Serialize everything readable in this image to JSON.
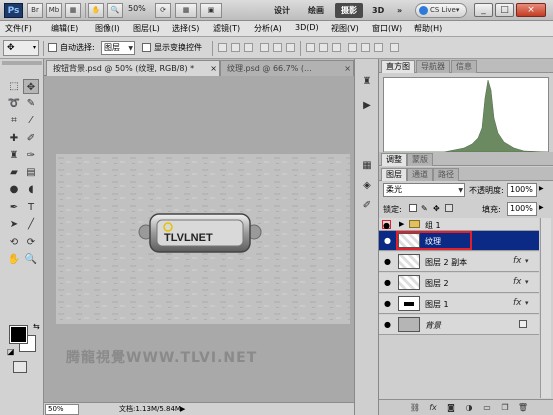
{
  "titlebar": {
    "app_logo": "Ps",
    "buttons": [
      "Br",
      "Mb"
    ],
    "zoom": "50%",
    "workspaces": [
      "设计",
      "绘画",
      "摄影",
      "3D"
    ],
    "active_workspace": "摄影",
    "more": "»",
    "cslive": "CS Live▾",
    "window_buttons": [
      "_",
      "□",
      "×"
    ]
  },
  "menubar": {
    "items": [
      "文件(F)",
      "编辑(E)",
      "图像(I)",
      "图层(L)",
      "选择(S)",
      "滤镜(T)",
      "分析(A)",
      "3D(D)",
      "视图(V)",
      "窗口(W)",
      "帮助(H)"
    ]
  },
  "options": {
    "auto_select_label": "自动选择:",
    "auto_select_value": "图层",
    "show_transform_label": "显示变换控件"
  },
  "document": {
    "tabs": [
      {
        "label": "按钮背景.psd @ 50% (纹理, RGB/8) *",
        "close": "×"
      },
      {
        "label": "纹理.psd @ 66.7% (...",
        "close": "×"
      }
    ],
    "button_text": "TLVLNET",
    "status_zoom": "50%",
    "status_doc": "文档:1.13M/5.84M",
    "watermark": "腾龍視覺WWW.TLVI.NET"
  },
  "panels": {
    "top_tabs": [
      "直方图",
      "导航器",
      "信息"
    ],
    "mid_tabs": [
      "调整",
      "蒙版"
    ],
    "layer_tabs": [
      "图层",
      "通道",
      "路径"
    ],
    "blend_mode": "柔光",
    "opacity_label": "不透明度:",
    "opacity_value": "100%",
    "lock_label": "锁定:",
    "fill_label": "填充:",
    "fill_value": "100%",
    "layers": [
      {
        "name": "组 1",
        "type": "group",
        "selected": false
      },
      {
        "name": "纹理",
        "type": "layer",
        "selected": true,
        "fx": false
      },
      {
        "name": "图层 2 副本",
        "type": "layer",
        "selected": false,
        "fx": true
      },
      {
        "name": "图层 2",
        "type": "layer",
        "selected": false,
        "fx": true
      },
      {
        "name": "图层 1",
        "type": "layer",
        "selected": false,
        "fx": true
      },
      {
        "name": "背景",
        "type": "background",
        "selected": false,
        "locked": true
      }
    ],
    "fx_label": "fx"
  },
  "colors": {
    "selection_blue": "#0a2a85",
    "highlight_red": "#e0202a"
  }
}
